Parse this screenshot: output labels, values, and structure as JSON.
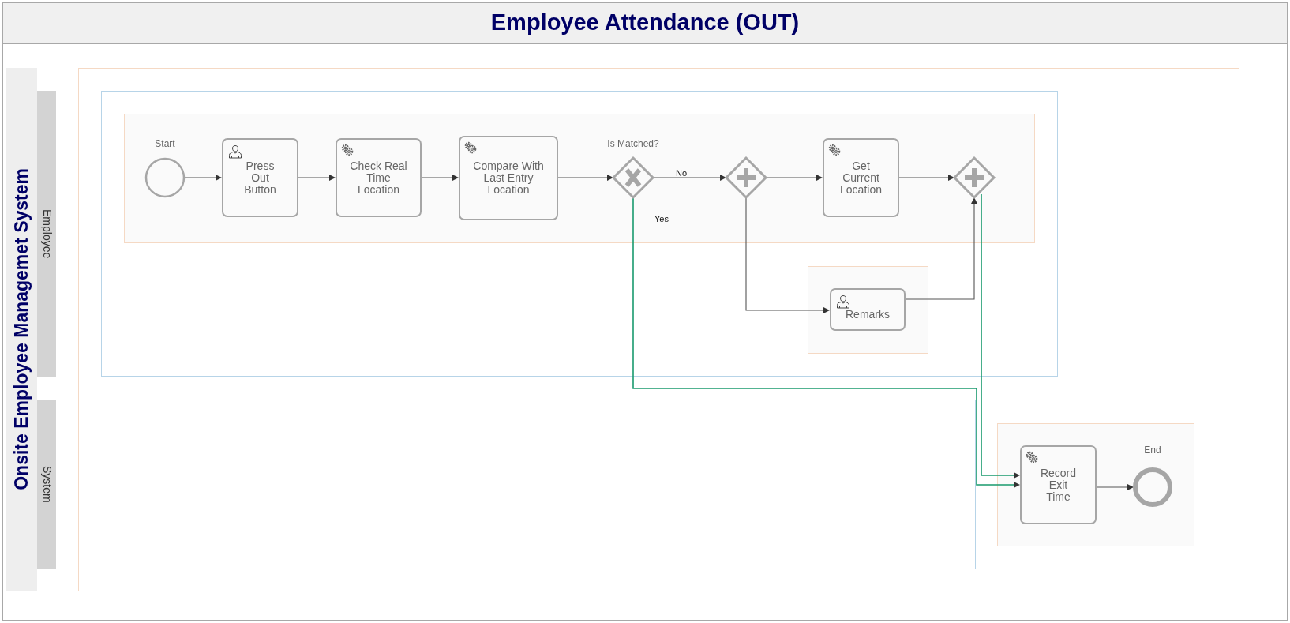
{
  "title": "Employee Attendance (OUT)",
  "pool": {
    "label": "Onsite Employee Managemet System"
  },
  "lanes": [
    {
      "label": "Employee"
    },
    {
      "label": "System"
    }
  ],
  "nodes": [
    {
      "kind": "start",
      "label": "Start"
    },
    {
      "kind": "user-task",
      "label": "Press Out Button"
    },
    {
      "kind": "service-task",
      "label": "Check Real Time Location"
    },
    {
      "kind": "service-task",
      "label": "Compare With Last Entry Location"
    },
    {
      "kind": "exclusive-gateway",
      "label": "Is Matched?"
    },
    {
      "kind": "parallel-gateway"
    },
    {
      "kind": "service-task",
      "label": "Get Current Location"
    },
    {
      "kind": "parallel-gateway"
    },
    {
      "kind": "user-task",
      "label": "Remarks"
    },
    {
      "kind": "service-task",
      "label": "Record Exit Time"
    },
    {
      "kind": "end",
      "label": "End"
    }
  ],
  "flows": [
    {
      "highlighted": false
    },
    {
      "highlighted": false
    },
    {
      "highlighted": false
    },
    {
      "highlighted": false
    },
    {
      "highlighted": false,
      "label": "No"
    },
    {
      "highlighted": false
    },
    {
      "highlighted": false
    },
    {
      "highlighted": false
    },
    {
      "highlighted": false
    },
    {
      "highlighted": true,
      "label": "Yes"
    },
    {
      "highlighted": true
    },
    {
      "highlighted": false
    }
  ]
}
